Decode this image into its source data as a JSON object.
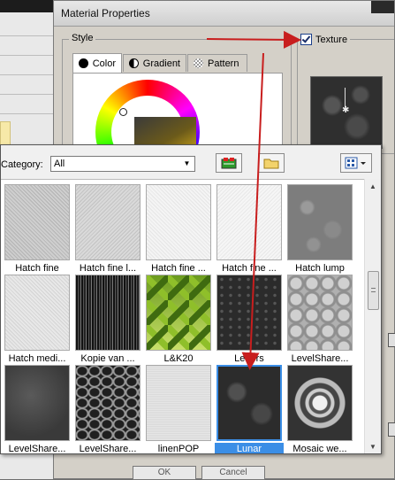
{
  "dialog": {
    "title": "Material Properties",
    "style_label": "Style",
    "texture_label": "Texture",
    "texture_checked": true,
    "tabs": [
      {
        "label": "Color",
        "icon": "color-dot-icon",
        "active": true
      },
      {
        "label": "Gradient",
        "icon": "gradient-icon",
        "active": false
      },
      {
        "label": "Pattern",
        "icon": "pattern-icon",
        "active": false
      }
    ],
    "buttons": [
      "OK",
      "Cancel"
    ]
  },
  "picker": {
    "category_label": "Category:",
    "category_value": "All",
    "toolbar_icons": [
      "texture-manager-icon",
      "folder-icon",
      "view-mode-icon"
    ],
    "textures": [
      {
        "name": "Hatch fine",
        "pattern": "hatch-light"
      },
      {
        "name": "Hatch fine l...",
        "pattern": "hatch-light"
      },
      {
        "name": "Hatch fine ...",
        "pattern": "hatch-white"
      },
      {
        "name": "Hatch fine ...",
        "pattern": "hatch-white"
      },
      {
        "name": "Hatch lump",
        "pattern": "lump"
      },
      {
        "name": "Hatch medi...",
        "pattern": "hatch-medium"
      },
      {
        "name": "Kopie van ...",
        "pattern": "stripes-dark"
      },
      {
        "name": "L&K20",
        "pattern": "green-diamonds"
      },
      {
        "name": "Letters",
        "pattern": "letters-dark"
      },
      {
        "name": "LevelShare...",
        "pattern": "leaves-grey"
      },
      {
        "name": "LevelShare...",
        "pattern": "dark-grey"
      },
      {
        "name": "LevelShare...",
        "pattern": "dark-swirl"
      },
      {
        "name": "linenPOP",
        "pattern": "linen"
      },
      {
        "name": "Lunar",
        "pattern": "lunar",
        "selected": true
      },
      {
        "name": "Mosaic we...",
        "pattern": "mosaic"
      }
    ]
  },
  "colors": {
    "arrow": "#c81e1e",
    "selection": "#3b8ee6"
  }
}
